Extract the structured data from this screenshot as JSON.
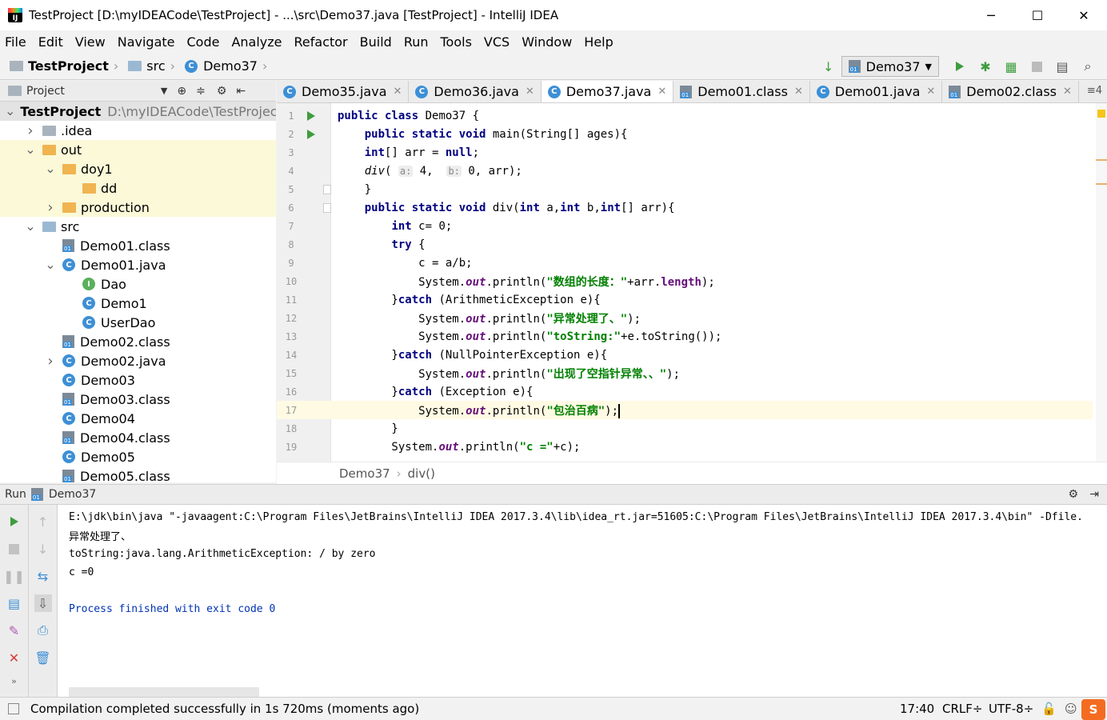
{
  "window": {
    "title": "TestProject [D:\\myIDEACode\\TestProject] - ...\\src\\Demo37.java [TestProject] - IntelliJ IDEA",
    "minimize": "─",
    "maximize": "☐",
    "close": "✕"
  },
  "menu": [
    "File",
    "Edit",
    "View",
    "Navigate",
    "Code",
    "Analyze",
    "Refactor",
    "Build",
    "Run",
    "Tools",
    "VCS",
    "Window",
    "Help"
  ],
  "breadcrumbs": [
    "TestProject",
    "src",
    "Demo37"
  ],
  "run_config": "Demo37",
  "project_panel": {
    "title": "Project",
    "rows": [
      {
        "label": "TestProject",
        "extra": "D:\\myIDEACode\\TestProjec",
        "icon": "folder-gray",
        "indent": 0,
        "arrow": "down",
        "bold": true,
        "style": "sel"
      },
      {
        "label": ".idea",
        "icon": "folder-gray",
        "indent": 1,
        "arrow": "right"
      },
      {
        "label": "out",
        "icon": "folder-orange",
        "indent": 1,
        "arrow": "down",
        "style": "hl"
      },
      {
        "label": "doy1",
        "icon": "folder-orange",
        "indent": 2,
        "arrow": "down",
        "style": "hl"
      },
      {
        "label": "dd",
        "icon": "folder-orange",
        "indent": 3,
        "arrow": "",
        "style": "hl"
      },
      {
        "label": "production",
        "icon": "folder-orange",
        "indent": 2,
        "arrow": "right",
        "style": "hl"
      },
      {
        "label": "src",
        "icon": "folder-blue",
        "indent": 1,
        "arrow": "down"
      },
      {
        "label": "Demo01.class",
        "icon": "class",
        "indent": 2,
        "arrow": ""
      },
      {
        "label": "Demo01.java",
        "icon": "c",
        "indent": 2,
        "arrow": "down"
      },
      {
        "label": "Dao",
        "icon": "i",
        "indent": 3,
        "arrow": ""
      },
      {
        "label": "Demo1",
        "icon": "c",
        "indent": 3,
        "arrow": ""
      },
      {
        "label": "UserDao",
        "icon": "c",
        "indent": 3,
        "arrow": ""
      },
      {
        "label": "Demo02.class",
        "icon": "class",
        "indent": 2,
        "arrow": ""
      },
      {
        "label": "Demo02.java",
        "icon": "c",
        "indent": 2,
        "arrow": "right"
      },
      {
        "label": "Demo03",
        "icon": "c",
        "indent": 2,
        "arrow": ""
      },
      {
        "label": "Demo03.class",
        "icon": "class",
        "indent": 2,
        "arrow": ""
      },
      {
        "label": "Demo04",
        "icon": "c",
        "indent": 2,
        "arrow": ""
      },
      {
        "label": "Demo04.class",
        "icon": "class",
        "indent": 2,
        "arrow": ""
      },
      {
        "label": "Demo05",
        "icon": "c",
        "indent": 2,
        "arrow": ""
      },
      {
        "label": "Demo05.class",
        "icon": "class",
        "indent": 2,
        "arrow": ""
      }
    ]
  },
  "tabs": [
    {
      "label": "Demo35.java",
      "icon": "c"
    },
    {
      "label": "Demo36.java",
      "icon": "c"
    },
    {
      "label": "Demo37.java",
      "icon": "c",
      "active": true
    },
    {
      "label": "Demo01.class",
      "icon": "class"
    },
    {
      "label": "Demo01.java",
      "icon": "c"
    },
    {
      "label": "Demo02.class",
      "icon": "class"
    }
  ],
  "tabs_overflow": "≡4",
  "code_lines": [
    {
      "n": "1",
      "mark": "run",
      "html": "<span class=\"kw\">public class</span> Demo37 {"
    },
    {
      "n": "2",
      "mark": "run",
      "html": "    <span class=\"kw\">public static void</span> main(String[] ages){"
    },
    {
      "n": "3",
      "html": "    <span class=\"kw\">int</span>[] arr = <span class=\"kw\">null</span>;"
    },
    {
      "n": "4",
      "html": "    <span class=\"itl\">div</span>( <span class=\"hint\">a:</span> 4,  <span class=\"hint\">b:</span> 0, arr);"
    },
    {
      "n": "5",
      "mark": "fold",
      "html": "    }"
    },
    {
      "n": "6",
      "mark": "fold",
      "html": "    <span class=\"kw\">public static void</span> div(<span class=\"kw\">int</span> a,<span class=\"kw\">int</span> b,<span class=\"kw\">int</span>[] arr){"
    },
    {
      "n": "7",
      "html": "        <span class=\"kw\">int</span> c= 0;"
    },
    {
      "n": "8",
      "html": "        <span class=\"kw\">try</span> {"
    },
    {
      "n": "9",
      "html": "            c = a/b;"
    },
    {
      "n": "10",
      "html": "            System.<span class=\"fld\">out</span>.println(<span class=\"str\">\"数组的长度：\"</span>+arr.<span class=\"fld\" style=\"font-style:normal\">length</span>);"
    },
    {
      "n": "11",
      "html": "        }<span class=\"kw\">catch</span> (ArithmeticException e){"
    },
    {
      "n": "12",
      "html": "            System.<span class=\"fld\">out</span>.println(<span class=\"str\">\"异常处理了、\"</span>);"
    },
    {
      "n": "13",
      "html": "            System.<span class=\"fld\">out</span>.println(<span class=\"str\">\"toString:\"</span>+e.toString());"
    },
    {
      "n": "14",
      "html": "        }<span class=\"kw\">catch</span> (NullPointerException e){"
    },
    {
      "n": "15",
      "html": "            System.<span class=\"fld\">out</span>.println(<span class=\"str\">\"出现了空指针异常、、\"</span>);"
    },
    {
      "n": "16",
      "html": "        }<span class=\"kw\">catch</span> (Exception e){"
    },
    {
      "n": "17",
      "cur": true,
      "html": "            System.<span class=\"fld\">out</span>.println(<span class=\"str\">\"包治百病\"</span>);"
    },
    {
      "n": "18",
      "html": "        }"
    },
    {
      "n": "19",
      "html": "        System.<span class=\"fld\">out</span>.println(<span class=\"str\">\"c =\"</span>+c);"
    }
  ],
  "editor_breadcrumb": [
    "Demo37",
    "div()"
  ],
  "run_panel": {
    "label": "Run",
    "config": "Demo37"
  },
  "console_lines": [
    {
      "text": "E:\\jdk\\bin\\java \"-javaagent:C:\\Program Files\\JetBrains\\IntelliJ IDEA 2017.3.4\\lib\\idea_rt.jar=51605:C:\\Program Files\\JetBrains\\IntelliJ IDEA 2017.3.4\\bin\" -Dfile.",
      "color": "#000"
    },
    {
      "text": "异常处理了、",
      "color": "#000"
    },
    {
      "text": "toString:java.lang.ArithmeticException: / by zero",
      "color": "#000"
    },
    {
      "text": "c =0",
      "color": "#000"
    },
    {
      "text": "",
      "color": "#000"
    },
    {
      "text": "Process finished with exit code 0",
      "color": "#0033b3"
    }
  ],
  "status": {
    "message": "Compilation completed successfully in 1s 720ms (moments ago)",
    "position": "17:40",
    "line_sep": "CRLF÷",
    "encoding": "UTF-8÷"
  }
}
